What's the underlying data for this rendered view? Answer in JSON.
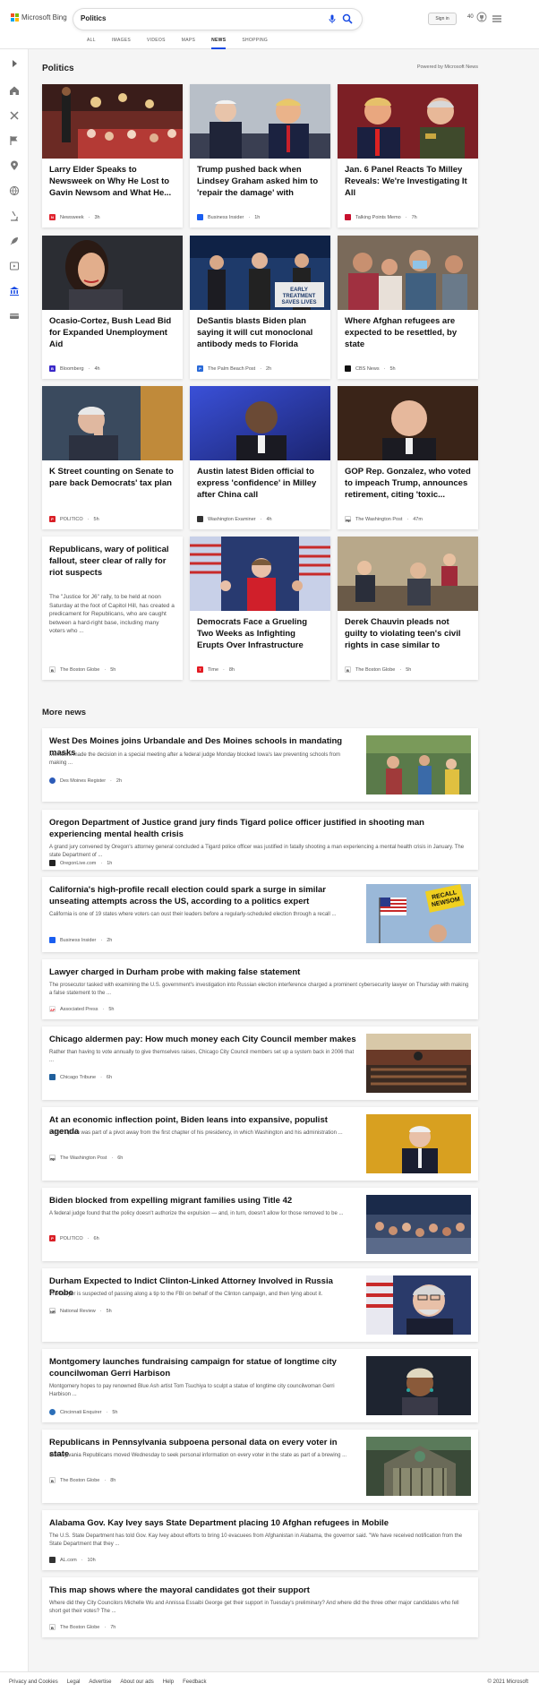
{
  "header": {
    "logo_text": "Microsoft Bing",
    "search_value": "Politics",
    "signin_label": "Sign in",
    "rewards_points": "40",
    "tabs": [
      {
        "label": "ALL"
      },
      {
        "label": "IMAGES"
      },
      {
        "label": "VIDEOS"
      },
      {
        "label": "MAPS"
      },
      {
        "label": "NEWS",
        "active": true
      },
      {
        "label": "SHOPPING"
      }
    ]
  },
  "section": {
    "title": "Politics",
    "powered": "Powered by Microsoft News"
  },
  "cards": [
    {
      "title": "Larry Elder Speaks to Newsweek on Why He Lost to Gavin Newsom and What He...",
      "source": "Newsweek",
      "time": "3h",
      "icon_color": "#e0242f",
      "icon_letter": "N"
    },
    {
      "title": "Trump pushed back when Lindsey Graham asked him to 'repair the damage' with Penc...",
      "source": "Business Insider",
      "time": "1h",
      "icon_color": "#1a5ef0",
      "icon_letter": ""
    },
    {
      "title": "Jan. 6 Panel Reacts To Milley Reveals: We're Investigating It All",
      "source": "Talking Points Memo",
      "time": "7h",
      "icon_color": "#c8102e",
      "icon_letter": ""
    },
    {
      "title": "Ocasio-Cortez, Bush Lead Bid for Expanded Unemployment Aid",
      "source": "Bloomberg",
      "time": "4h",
      "icon_color": "#3a28c8",
      "icon_letter": "B"
    },
    {
      "title": "DeSantis blasts Biden plan saying it will cut monoclonal antibody meds to Florida",
      "source": "The Palm Beach Post",
      "time": "2h",
      "icon_color": "#2a6ad8",
      "icon_letter": "P"
    },
    {
      "title": "Where Afghan refugees are expected to be resettled, by state",
      "source": "CBS News",
      "time": "5h",
      "icon_color": "#111111",
      "icon_letter": ""
    },
    {
      "title": "K Street counting on Senate to pare back Democrats' tax plan",
      "source": "POLITICO",
      "time": "5h",
      "icon_color": "#d91f26",
      "icon_letter": "P"
    },
    {
      "title": "Austin latest Biden official to express 'confidence' in Milley after China call",
      "source": "Washington Examiner",
      "time": "4h",
      "icon_color": "#333333",
      "icon_letter": ""
    },
    {
      "title": "GOP Rep. Gonzalez, who voted to impeach Trump, announces retirement, citing 'toxic...",
      "source": "The Washington Post",
      "time": "47m",
      "icon_color": "#ffffff",
      "icon_letter": "wp"
    },
    {
      "title": "Republicans, wary of political fallout, steer clear of rally for riot suspects",
      "source": "The Boston Globe",
      "time": "5h",
      "icon_color": "#ffffff",
      "icon_letter": "B",
      "desc": "The \"Justice for J6\" rally, to be held at noon Saturday at the foot of Capitol Hill, has created a predicament for Republicans, who are caught between a hard-right base, including many voters who ..."
    },
    {
      "title": "Democrats Face a Grueling Two Weeks as Infighting Erupts Over Infrastructure",
      "source": "Time",
      "time": "8h",
      "icon_color": "#e31b23",
      "icon_letter": "T"
    },
    {
      "title": "Derek Chauvin pleads not guilty to violating teen's civil rights in case similar to George Floyd",
      "source": "The Boston Globe",
      "time": "5h",
      "icon_color": "#ffffff",
      "icon_letter": "B"
    }
  ],
  "more_news": {
    "title": "More news",
    "items": [
      {
        "title": "West Des Moines joins Urbandale and Des Moines schools in mandating masks",
        "desc": "Members made the decision in a special meeting after a federal judge Monday blocked Iowa's law preventing schools from making ...",
        "source": "Des Moines Register",
        "time": "2h",
        "icon_color": "#2c5bb8"
      },
      {
        "title": "Oregon Department of Justice grand jury finds Tigard police officer justified in shooting man experiencing mental health crisis",
        "desc": "A grand jury convened by Oregon's attorney general concluded a Tigard police officer was justified in fatally shooting a man experiencing a mental health crisis in January. The state Department of ...",
        "source": "OregonLive.com",
        "time": "1h",
        "icon_color": "#222222"
      },
      {
        "title": "California's high-profile recall election could spark a surge in similar unseating attempts across the US, according to a politics expert",
        "desc": "California is one of 19 states where voters can oust their leaders before a regularly-scheduled election through a recall ...",
        "source": "Business Insider",
        "time": "2h",
        "icon_color": "#1a5ef0"
      },
      {
        "title": "Lawyer charged in Durham probe with making false statement",
        "desc": "The prosecutor tasked with examining the U.S. government's investigation into Russian election interference charged a prominent cybersecurity lawyer on Thursday with making a false statement to the ...",
        "source": "Associated Press",
        "time": "5h",
        "icon_color": "#e21a22"
      },
      {
        "title": "Chicago aldermen pay: How much money each City Council member makes",
        "desc": "Rather than having to vote annually to give themselves raises, Chicago City Council members set up a system back in 2006 that ...",
        "source": "Chicago Tribune",
        "time": "6h",
        "icon_color": "#1f5f9c"
      },
      {
        "title": "At an economic inflection point, Biden leans into expansive, populist agenda",
        "desc": "Biden's pitch was part of a pivot away from the first chapter of his presidency, in which Washington and his administration ...",
        "source": "The Washington Post",
        "time": "6h",
        "icon_color": "#ffffff"
      },
      {
        "title": "Biden blocked from expelling migrant families using Title 42",
        "desc": "A federal judge found that the policy doesn't authorize the expulsion — and, in turn, doesn't allow for those removed to be ...",
        "source": "POLITICO",
        "time": "6h",
        "icon_color": "#d91f26"
      },
      {
        "title": "Durham Expected to Indict Clinton-Linked Attorney Involved in Russia Probe",
        "desc": "The lawyer is suspected of passing along a tip to the FBI on behalf of the Clinton campaign, and then lying about it.",
        "source": "National Review",
        "time": "5h",
        "icon_color": "#ffffff"
      },
      {
        "title": "Montgomery launches fundraising campaign for statue of longtime city councilwoman Gerri Harbison",
        "desc": "Montgomery hopes to pay renowned Blue Ash artist Tom Tsuchiya to sculpt a statue of longtime city councilwoman Gerri Harbison ...",
        "source": "Cincinnati Enquirer",
        "time": "5h",
        "icon_color": "#2c6fb8"
      },
      {
        "title": "Republicans in Pennsylvania subpoena personal data on every voter in state",
        "desc": "Pennsylvania Republicans moved Wednesday to seek personal information on every voter in the state as part of a brewing ...",
        "source": "The Boston Globe",
        "time": "8h",
        "icon_color": "#ffffff"
      },
      {
        "title": "Alabama Gov. Kay Ivey says State Department placing 10 Afghan refugees in Mobile",
        "desc": "The U.S. State Department has told Gov. Kay Ivey about efforts to bring 10 evacuees from Afghanistan in Alabama, the governor said. \"We have received notification from the State Department that they ...",
        "source": "AL.com",
        "time": "10h",
        "icon_color": "#333333"
      },
      {
        "title": "This map shows where the mayoral candidates got their support",
        "desc": "Where did they City Councilors Michelle Wu and Annissa Essaibi George get their support in Tuesday's preliminary? And where did the three other major candidates who fell short get their votes? The ...",
        "source": "The Boston Globe",
        "time": "7h",
        "icon_color": "#ffffff"
      }
    ]
  },
  "footer": {
    "links": [
      "Privacy and Cookies",
      "Legal",
      "Advertise",
      "About our ads",
      "Help",
      "Feedback"
    ],
    "copyright": "© 2021 Microsoft"
  }
}
